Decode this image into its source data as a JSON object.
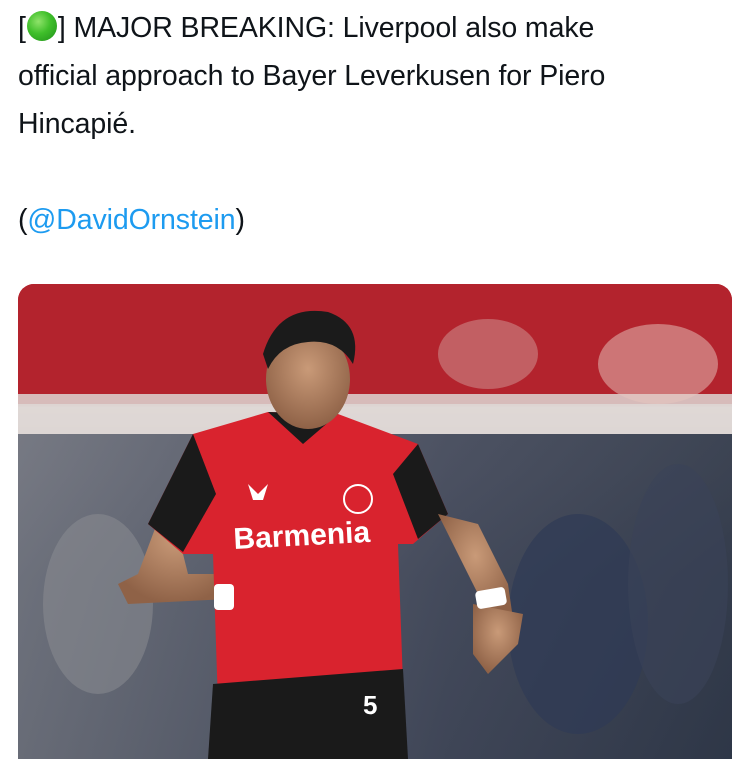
{
  "tweet": {
    "bracket_open": "[",
    "emoji_icon": "green-circle-emoji",
    "bracket_close_text": "] MAJOR BREAKING: Liverpool also make",
    "line2": "official approach to Bayer Leverkusen for Piero",
    "line3": "Hincapié.",
    "paren_open": "(",
    "mention": "@DavidOrnstein",
    "paren_close": ")"
  },
  "media": {
    "shirt_sponsor": "Barmenia",
    "shirt_number": "5",
    "colors": {
      "kit_red": "#d9232e",
      "kit_black": "#1a1a1a",
      "stadium_red": "#b5222c",
      "mention_blue": "#1d9bf0"
    }
  }
}
